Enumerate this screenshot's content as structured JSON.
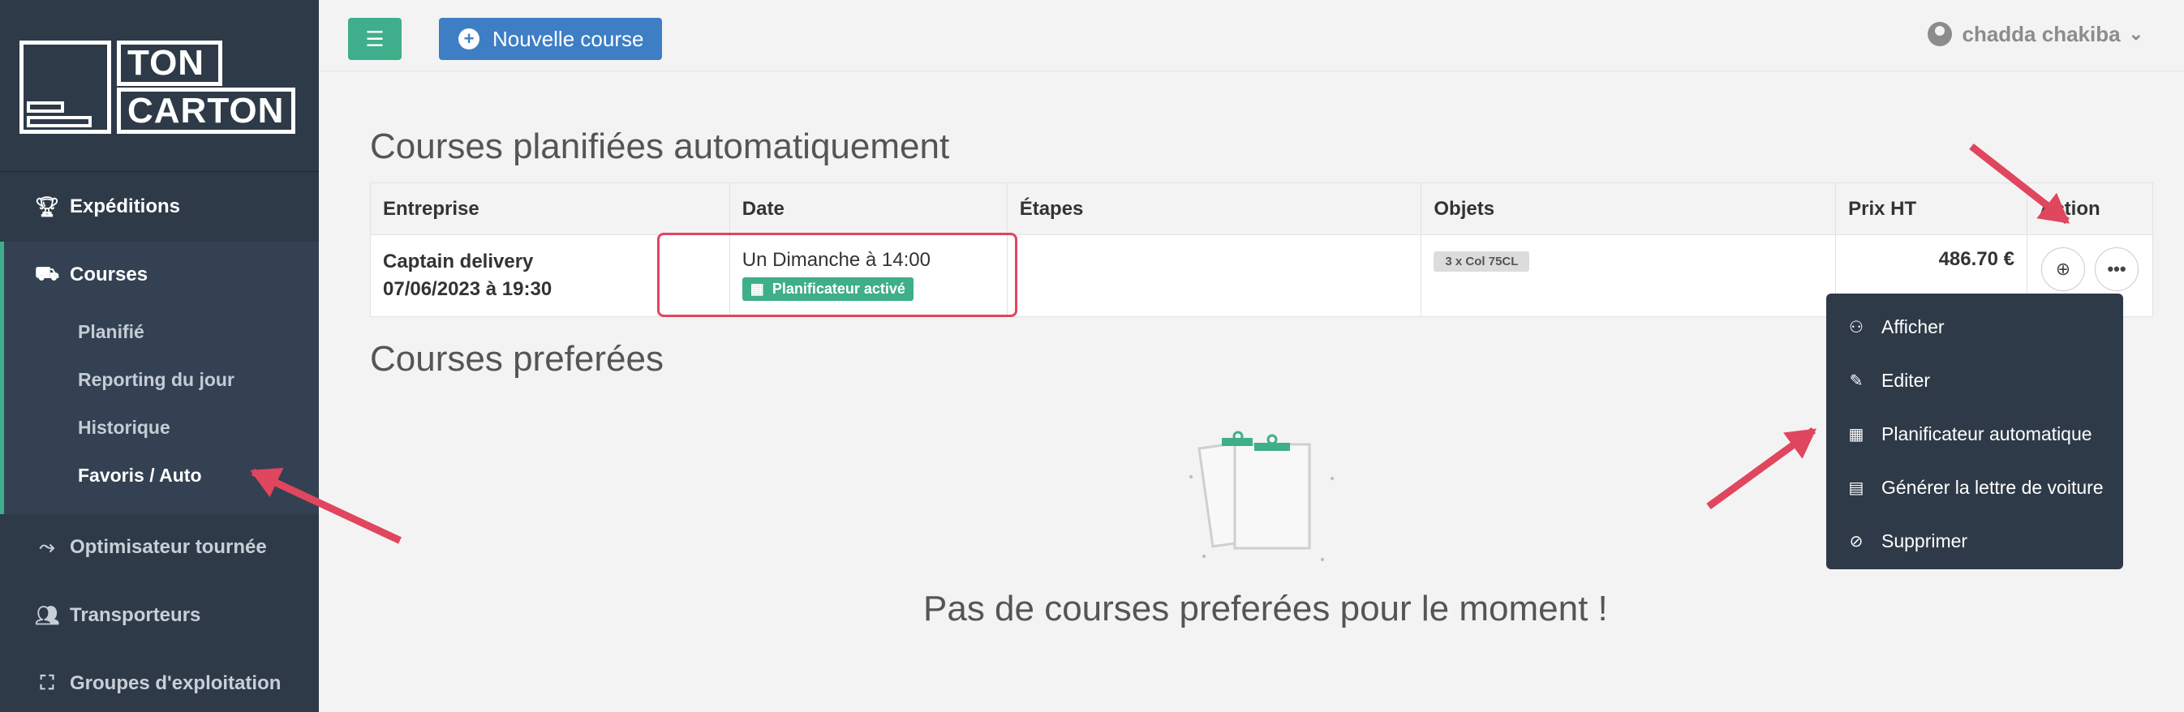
{
  "logo": {
    "line1": "TON",
    "line2": "CARTON"
  },
  "sidebar": {
    "items": [
      {
        "label": "Expéditions",
        "icon": "trophy-icon"
      },
      {
        "label": "Courses",
        "icon": "truck-icon"
      },
      {
        "label": "Optimisateur tournée",
        "icon": "route-icon"
      },
      {
        "label": "Transporteurs",
        "icon": "users-icon"
      },
      {
        "label": "Groupes d'exploitation",
        "icon": "dolly-icon"
      }
    ],
    "courses_sub": [
      "Planifié",
      "Reporting du jour",
      "Historique",
      "Favoris / Auto"
    ]
  },
  "topbar": {
    "new_course": "Nouvelle course",
    "user_name": "chadda chakiba"
  },
  "planned": {
    "title": "Courses planifiées automatiquement",
    "headers": [
      "Entreprise",
      "Date",
      "Étapes",
      "Objets",
      "Prix HT",
      "Action"
    ],
    "row": {
      "company": "Captain delivery",
      "company_date": "07/06/2023 à 19:30",
      "date": "Un Dimanche à 14:00",
      "badge": "Planificateur activé",
      "objects": "3 x Col 75CL",
      "price": "486.70 €"
    }
  },
  "dropdown": {
    "items": [
      {
        "label": "Afficher",
        "icon": "binoculars-icon"
      },
      {
        "label": "Editer",
        "icon": "pencil-icon"
      },
      {
        "label": "Planificateur automatique",
        "icon": "calendar-icon"
      },
      {
        "label": "Générer la lettre de voiture",
        "icon": "receipt-icon"
      },
      {
        "label": "Supprimer",
        "icon": "ban-icon"
      }
    ]
  },
  "favorites": {
    "title": "Courses preferées",
    "empty": "Pas de courses preferées pour le moment !"
  },
  "colors": {
    "accent_green": "#3fae8a",
    "primary_blue": "#3d7ec4",
    "annotation_red": "#e0465e",
    "sidebar": "#2e3a48"
  }
}
